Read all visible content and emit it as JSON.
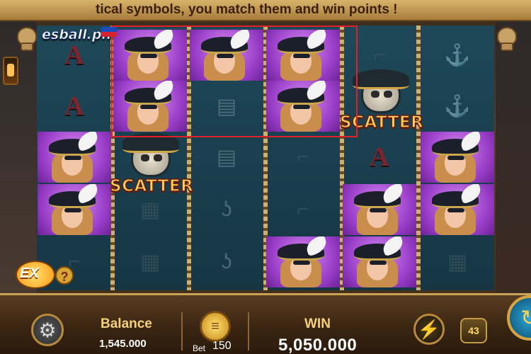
{
  "banner": {
    "text": "tical symbols, you match them and win points !"
  },
  "logo": {
    "text": "esball.ph"
  },
  "symbols": {
    "lady": "pirate-lady-symbol",
    "scatter_label": "SCATTER",
    "letter_a": "A"
  },
  "ex_badge": {
    "label": "EX",
    "help": "?"
  },
  "footer": {
    "balance_label": "Balance",
    "balance_value": "1,545.000",
    "bet_label": "Bet",
    "bet_value": "150",
    "win_label": "WIN",
    "win_value": "5,050.000",
    "auto_count": "43"
  },
  "colors": {
    "win_line": "#e0202a",
    "highlight_cell": "#9a3ec9",
    "label_gold": "#f5d07a"
  }
}
